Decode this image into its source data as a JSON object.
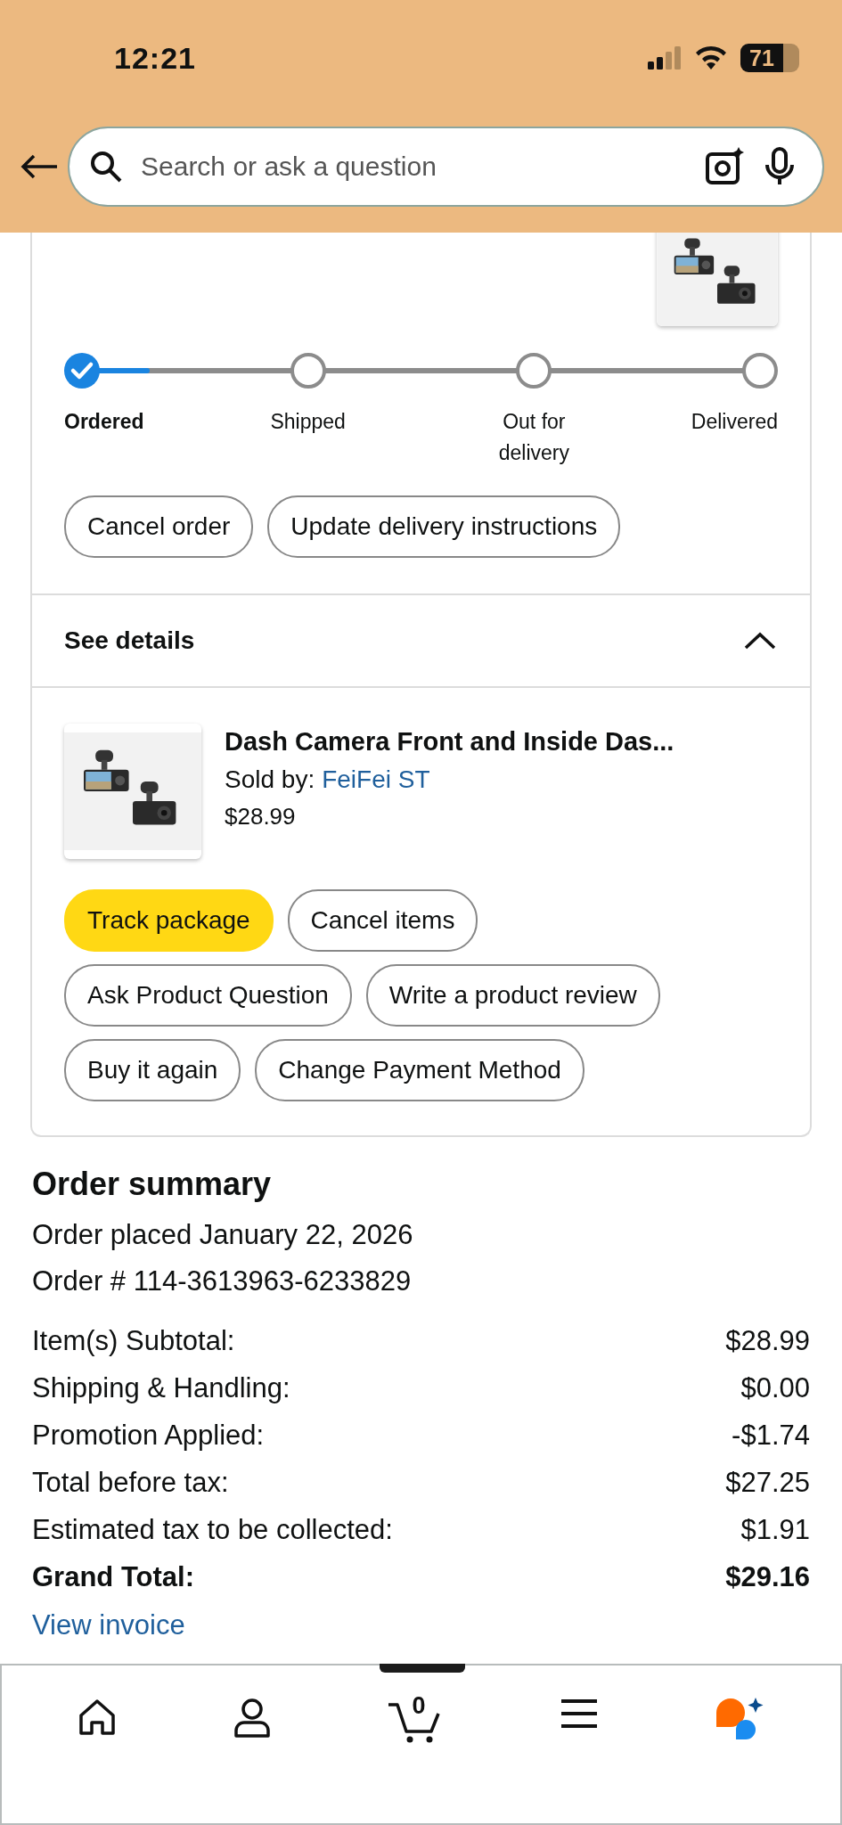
{
  "status_bar": {
    "time": "12:21",
    "battery": "71"
  },
  "search": {
    "placeholder": "Search or ask a question"
  },
  "delivery": {
    "progress": {
      "level": 0.08,
      "steps": [
        {
          "label": "Ordered",
          "completed": true
        },
        {
          "label": "Shipped",
          "completed": false
        },
        {
          "label": "Out for delivery",
          "completed": false
        },
        {
          "label": "Delivered",
          "completed": false
        }
      ]
    },
    "actions": [
      "Cancel order",
      "Update delivery instructions"
    ]
  },
  "details": {
    "label": "See details",
    "expanded": true
  },
  "item": {
    "title": "Dash Camera Front and Inside Das...",
    "seller_label": "Sold by:",
    "seller": "FeiFei ST",
    "price": "$28.99",
    "actions": [
      {
        "label": "Track package",
        "primary": true
      },
      {
        "label": "Cancel items",
        "primary": false
      },
      {
        "label": "Ask Product Question",
        "primary": false
      },
      {
        "label": "Write a product review",
        "primary": false
      },
      {
        "label": "Buy it again",
        "primary": false
      },
      {
        "label": "Change Payment Method",
        "primary": false
      }
    ]
  },
  "order_summary": {
    "title": "Order summary",
    "placed": "Order placed January 22, 2026",
    "number": "Order # 114-3613963-6233829",
    "rows": [
      {
        "label": "Item(s) Subtotal:",
        "value": "$28.99",
        "emphasis": false
      },
      {
        "label": "Shipping & Handling:",
        "value": "$0.00",
        "emphasis": false
      },
      {
        "label": "Promotion Applied:",
        "value": "-$1.74",
        "emphasis": false
      },
      {
        "label": "Total before tax:",
        "value": "$27.25",
        "emphasis": false
      },
      {
        "label": "Estimated tax to be collected:",
        "value": "$1.91",
        "emphasis": false
      },
      {
        "label": "Grand Total:",
        "value": "$29.16",
        "emphasis": true
      }
    ],
    "invoice_link": "View invoice"
  },
  "bottom_nav": {
    "cart_count": "0"
  }
}
